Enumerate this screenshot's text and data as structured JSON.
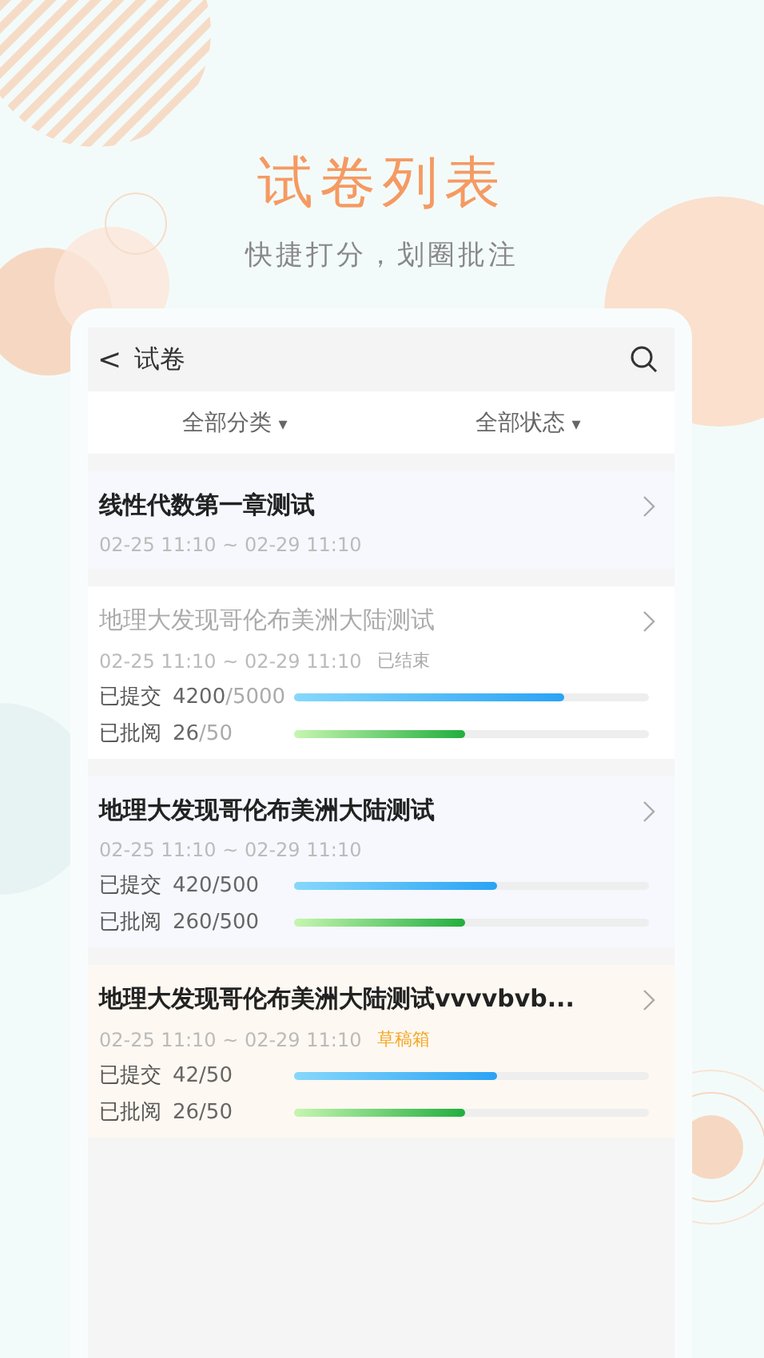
{
  "title": "试卷列表",
  "subtitle": "快捷打分，划圈批注",
  "header": {
    "back": "<",
    "title": "试卷"
  },
  "filters": [
    {
      "label": "全部分类",
      "caret": "▾"
    },
    {
      "label": "全部状态",
      "caret": "▾"
    }
  ],
  "exams": [
    {
      "title": "线性代数第一章测试",
      "time": "02-25 11:10 ~ 02-29 11:10",
      "kind": "plain",
      "ended": false
    },
    {
      "title": "地理大发现哥伦布美洲大陆测试",
      "time": "02-25 11:10 ~ 02-29 11:10",
      "kind": "progress",
      "ended": true,
      "status": {
        "text": "已结束",
        "kind": "ended"
      },
      "rows": [
        {
          "label": "已提交",
          "value": "4200",
          "total": "/5000",
          "level": 0.76
        },
        {
          "label": "已批阅",
          "value": "26",
          "total": "/50",
          "level": 0.48
        }
      ]
    },
    {
      "title": "地理大发现哥伦布美洲大陆测试",
      "time": "02-25 11:10 ~ 02-29 11:10",
      "kind": "progress",
      "ended": false,
      "rows": [
        {
          "label": "已提交",
          "value": "420",
          "total": "/500",
          "level": 0.57
        },
        {
          "label": "已批阅",
          "value": "260",
          "total": "/500",
          "level": 0.48
        }
      ]
    },
    {
      "title": "地理大发现哥伦布美洲大陆测试vvvvbvb...",
      "time": "02-25 11:10 ~ 02-29 11:10",
      "kind": "progress",
      "ended": false,
      "status": {
        "text": "草稿箱",
        "kind": "draft"
      },
      "rows": [
        {
          "label": "已提交",
          "value": "42",
          "total": "/50",
          "level": 0.57
        },
        {
          "label": "已批阅",
          "value": "26",
          "total": "/50",
          "level": 0.48
        }
      ]
    }
  ]
}
